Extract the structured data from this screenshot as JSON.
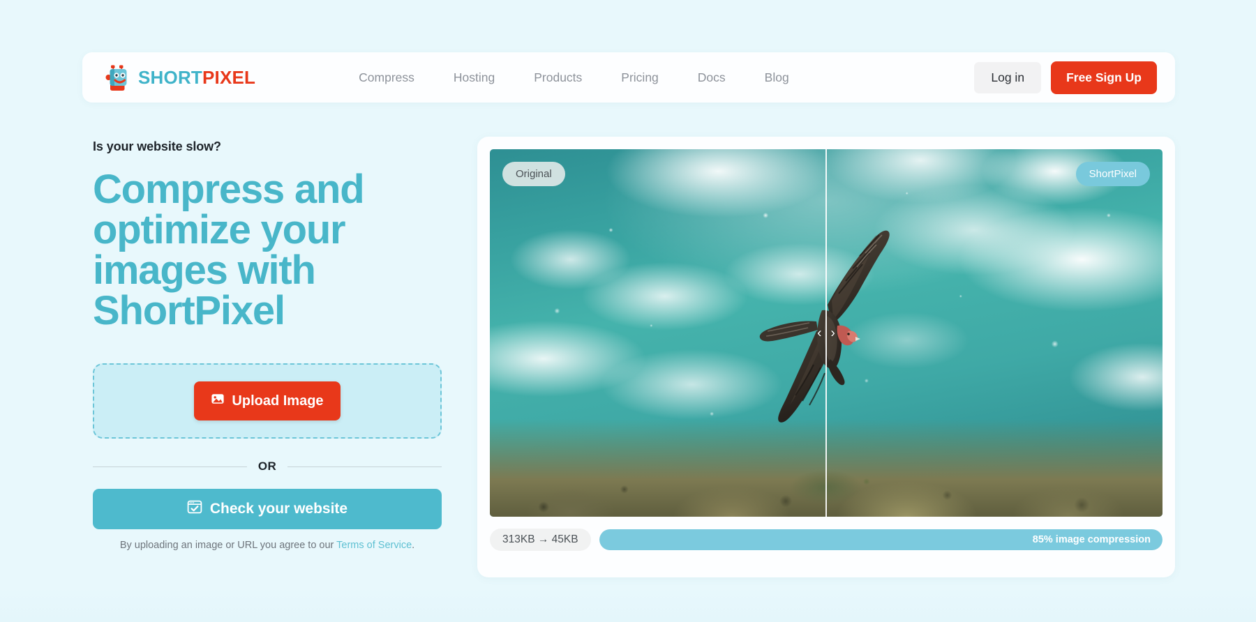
{
  "colors": {
    "page_background": "#e8f8fc",
    "brand_teal": "#48b6c9",
    "brand_red": "#e8381a",
    "card_white": "#fdfeff",
    "dropzone_fill": "#cbeef6",
    "dropzone_border": "#6cc5d8",
    "progress_fill": "#7bcade"
  },
  "header": {
    "logo": {
      "icon": "shortpixel-robot-icon",
      "text_primary": "SHORT",
      "text_secondary": "PIXEL"
    },
    "nav": [
      {
        "label": "Compress"
      },
      {
        "label": "Hosting"
      },
      {
        "label": "Products"
      },
      {
        "label": "Pricing"
      },
      {
        "label": "Docs"
      },
      {
        "label": "Blog"
      }
    ],
    "login_label": "Log in",
    "signup_label": "Free Sign Up"
  },
  "hero": {
    "eyebrow": "Is your website slow?",
    "headline": "Compress and optimize your images with ShortPixel",
    "upload_button": {
      "label": "Upload Image",
      "icon": "image-upload-icon"
    },
    "divider_label": "OR",
    "check_button": {
      "label": "Check your website",
      "icon": "browser-check-icon"
    },
    "terms_prefix": "By uploading an image or URL you agree to our ",
    "terms_link": "Terms of Service",
    "terms_suffix": "."
  },
  "comparison": {
    "badge_left": "Original",
    "badge_right": "ShortPixel",
    "slider_position_percent": 50,
    "handle_left_icon": "chevron-left-icon",
    "handle_right_icon": "chevron-right-icon",
    "photo_alt": "Turkey vulture soaring over turquoise ocean surf and rocky coastal cliffs",
    "stats": {
      "size_original": "313KB",
      "size_arrow": "→",
      "size_optimized": "45KB",
      "size_summary": "313KB → 45KB",
      "compression_label": "85% image compression",
      "compression_percent": 85
    }
  }
}
